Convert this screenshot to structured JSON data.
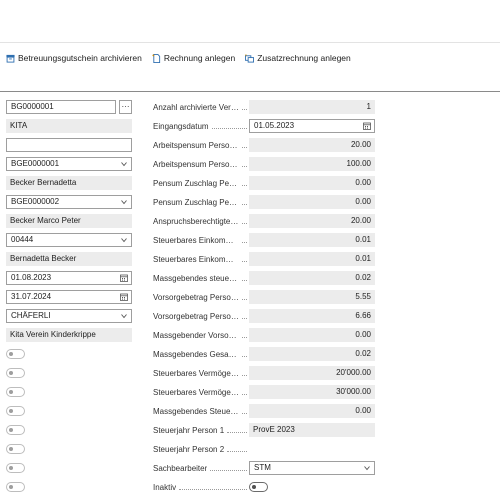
{
  "toolbar": {
    "btn1": "Betreuungsgutschein archivieren",
    "btn2": "Rechnung anlegen",
    "btn3": "Zusatzrechnung anlegen"
  },
  "left": {
    "f1": "BG0000001",
    "f1_more": "···",
    "f2": "KITA",
    "f3": "",
    "f4": "BGE0000001",
    "f5": "Becker Bernadetta",
    "f6": "BGE0000002",
    "f7": "Becker Marco Peter",
    "f8": "00444",
    "f9": "Bernadetta Becker",
    "f10": "01.08.2023",
    "f11": "31.07.2024",
    "f12": "CHÄFERLI",
    "f13": "Kita Verein Kinderkrippe"
  },
  "right": {
    "r1_label": "Anzahl archivierte Versio...",
    "r1_value": "1",
    "r2_label": "Eingangsdatum",
    "r2_value": "01.05.2023",
    "r3_label": "Arbeitspensum Person 1",
    "r3_value": "20.00",
    "r4_label": "Arbeitspensum Person 2",
    "r4_value": "100.00",
    "r5_label": "Pensum Zuschlag Person 1",
    "r5_value": "0.00",
    "r6_label": "Pensum Zuschlag Person 2",
    "r6_value": "0.00",
    "r7_label": "Anspruchsberechtigtes P...",
    "r7_value": "20.00",
    "r8_label": "Steuerbares Einkommen ...",
    "r8_value": "0.01",
    "r9_label": "Steuerbares Einkommen ...",
    "r9_value": "0.01",
    "r10_label": "Massgebendes steuerbar...",
    "r10_value": "0.02",
    "r11_label": "Vorsorgebetrag Person 1",
    "r11_value": "5.55",
    "r12_label": "Vorsorgebetrag Person 2",
    "r12_value": "6.66",
    "r13_label": "Massgebender Vorsorge...",
    "r13_value": "0.00",
    "r14_label": "Massgebendes Gesamtei...",
    "r14_value": "0.02",
    "r15_label": "Steuerbares Vermögen P...",
    "r15_value": "20'000.00",
    "r16_label": "Steuerbares Vermögen P...",
    "r16_value": "30'000.00",
    "r17_label": "Massgebendes Steuerbar...",
    "r17_value": "0.00",
    "r18_label": "Steuerjahr Person 1",
    "r18_value": "ProvE 2023",
    "r19_label": "Steuerjahr Person 2",
    "r19_value": "",
    "r20_label": "Sachbearbeiter",
    "r20_value": "STM",
    "r21_label": "Inaktiv"
  }
}
